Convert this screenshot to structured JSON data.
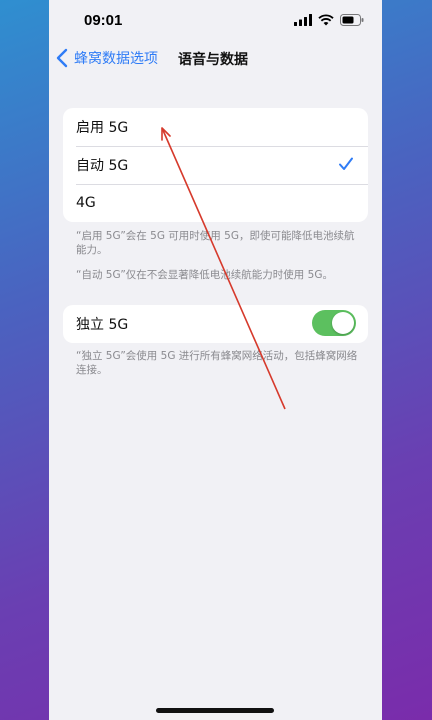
{
  "status": {
    "time": "09:01"
  },
  "nav": {
    "back_label": "蜂窝数据选项",
    "title": "语音与数据"
  },
  "options": [
    {
      "label": "启用 5G",
      "selected": false
    },
    {
      "label": "自动 5G",
      "selected": true
    },
    {
      "label": "4G",
      "selected": false
    }
  ],
  "notes": {
    "enable_5g": "“启用 5G”会在 5G 可用时使用 5G，即使可能降低电池续航能力。",
    "auto_5g": "“自动 5G”仅在不会显著降低电池续航能力时使用 5G。",
    "standalone": "“独立 5G”会使用 5G 进行所有蜂窝网络活动，包括蜂窝网络连接。"
  },
  "standalone": {
    "label": "独立 5G",
    "enabled": true
  },
  "colors": {
    "accent": "#2f7cf6",
    "toggle_on": "#5cc05f",
    "annotation_arrow": "#d63a2c"
  }
}
